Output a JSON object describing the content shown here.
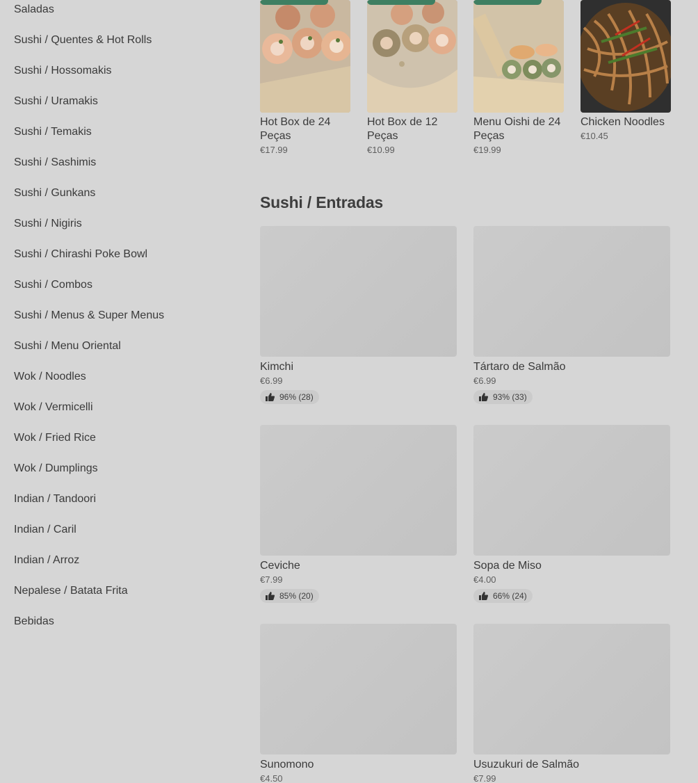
{
  "sidebar": {
    "items": [
      "Saladas",
      "Sushi / Quentes & Hot Rolls",
      "Sushi / Hossomakis",
      "Sushi / Uramakis",
      "Sushi / Temakis",
      "Sushi / Sashimis",
      "Sushi / Gunkans",
      "Sushi / Nigiris",
      "Sushi / Chirashi Poke Bowl",
      "Sushi / Combos",
      "Sushi / Menus & Super Menus",
      "Sushi / Menu Oriental",
      "Wok / Noodles",
      "Wok / Vermicelli",
      "Wok / Fried Rice",
      "Wok / Dumplings",
      "Indian / Tandoori",
      "Indian / Caril",
      "Indian / Arroz",
      "Nepalese / Batata Frita",
      "Bebidas"
    ]
  },
  "featured": [
    {
      "name": "Hot Box de 24 Peças",
      "price": "€17.99"
    },
    {
      "name": "Hot Box de 12 Peças",
      "price": "€10.99"
    },
    {
      "name": "Menu Oishi de 24 Peças",
      "price": "€19.99"
    },
    {
      "name": "Chicken Noodles",
      "price": "€10.45"
    }
  ],
  "section": {
    "title": "Sushi / Entradas",
    "items": [
      {
        "name": "Kimchi",
        "price": "€6.99",
        "rating": "96% (28)"
      },
      {
        "name": "Tártaro de Salmão",
        "price": "€6.99",
        "rating": "93% (33)"
      },
      {
        "name": "Ceviche",
        "price": "€7.99",
        "rating": "85% (20)"
      },
      {
        "name": "Sopa de Miso",
        "price": "€4.00",
        "rating": "66% (24)"
      },
      {
        "name": "Sunomono",
        "price": "€4.50"
      },
      {
        "name": "Usuzukuri de Salmão",
        "price": "€7.99"
      }
    ]
  },
  "colors": {
    "background": "#d6d6d6",
    "badge": "#3e7f62",
    "text": "#3a3a3a"
  }
}
